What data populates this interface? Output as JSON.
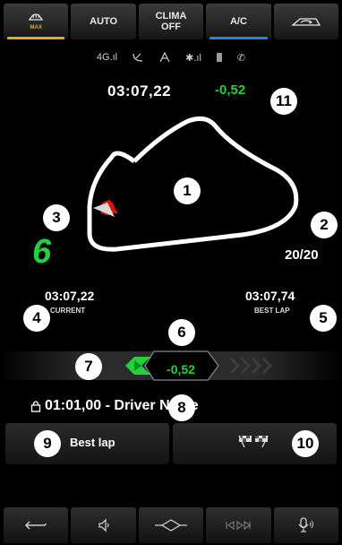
{
  "climate_bar": {
    "defrost": {
      "icon": "windshield-defrost-icon",
      "label": "MAX"
    },
    "auto": "AUTO",
    "clima_off": "CLIMA OFF",
    "ac": "A/C",
    "recirc": {
      "icon": "air-recirculation-icon"
    }
  },
  "status_bar": {
    "network": "4G",
    "icons": [
      "signal-bars-icon",
      "satellite-dish-icon",
      "gps-icon",
      "bluetooth-icon",
      "phone-battery-icon",
      "phone-icon"
    ]
  },
  "top": {
    "lap_time": "03:07,22",
    "delta": "-0,52"
  },
  "track": {
    "gear": "6",
    "lap_counter": "20/20"
  },
  "times": {
    "current": {
      "time": "03:07,22",
      "label": "CURRENT"
    },
    "best": {
      "time": "03:07,74",
      "label": "BEST LAP"
    }
  },
  "delta_bar": {
    "value": "-0,52"
  },
  "driver": {
    "text": "01:01,00 - Driver Name"
  },
  "cards": {
    "left_label": "Best lap",
    "right_icon": "checkered-flags-icon"
  },
  "badges": {
    "track": "1",
    "lap_counter": "2",
    "gear": "3",
    "current": "4",
    "best": "5",
    "delta_label": "6",
    "delta_bar": "7",
    "driver": "8",
    "best_lap_card": "9",
    "flag_card": "10",
    "top_time": "11"
  },
  "navbar": {
    "icons": [
      "back-icon",
      "volume-icon",
      "home-icon",
      "media-skip-icon",
      "voice-mic-icon"
    ]
  },
  "colors": {
    "accent_green": "#22d23a",
    "defrost_orange": "#e7a52a",
    "ac_blue": "#2f7fe0"
  }
}
